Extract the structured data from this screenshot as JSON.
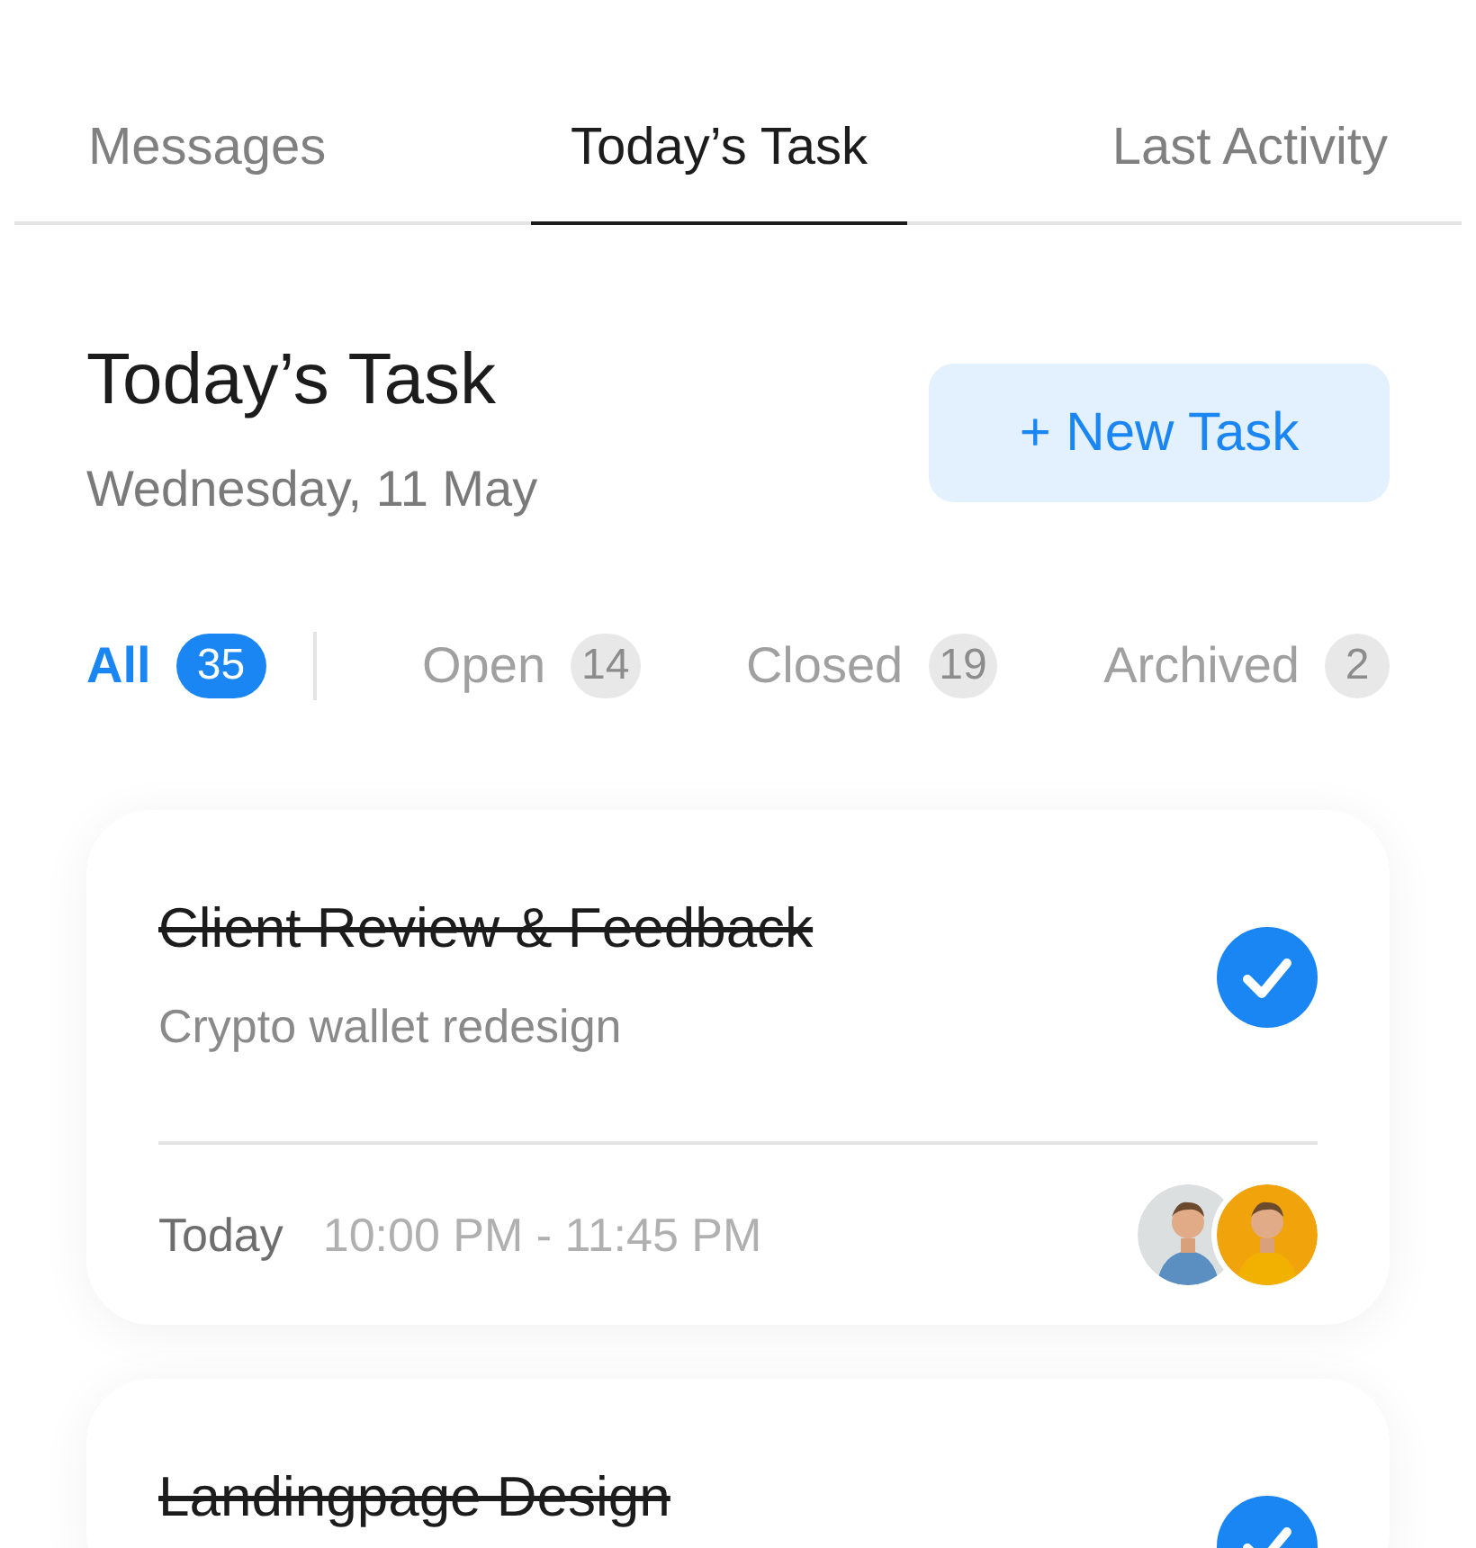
{
  "tabs": [
    {
      "label": "Messages",
      "selected": false
    },
    {
      "label": "Today’s Task",
      "selected": true
    },
    {
      "label": "Last Activity",
      "selected": false
    }
  ],
  "header": {
    "title": "Today’s Task",
    "date": "Wednesday, 11 May",
    "new_task_button": "+ New Task"
  },
  "filters": [
    {
      "label": "All",
      "count": "35",
      "selected": true
    },
    {
      "label": "Open",
      "count": "14",
      "selected": false
    },
    {
      "label": "Closed",
      "count": "19",
      "selected": false
    },
    {
      "label": "Archived",
      "count": "2",
      "selected": false
    }
  ],
  "tasks": [
    {
      "title": "Client Review & Feedback",
      "subtitle": "Crypto wallet redesign",
      "done": true,
      "day": "Today",
      "time": "10:00 PM - 11:45 PM"
    },
    {
      "title": "Landingpage Design",
      "done": true
    }
  ]
}
